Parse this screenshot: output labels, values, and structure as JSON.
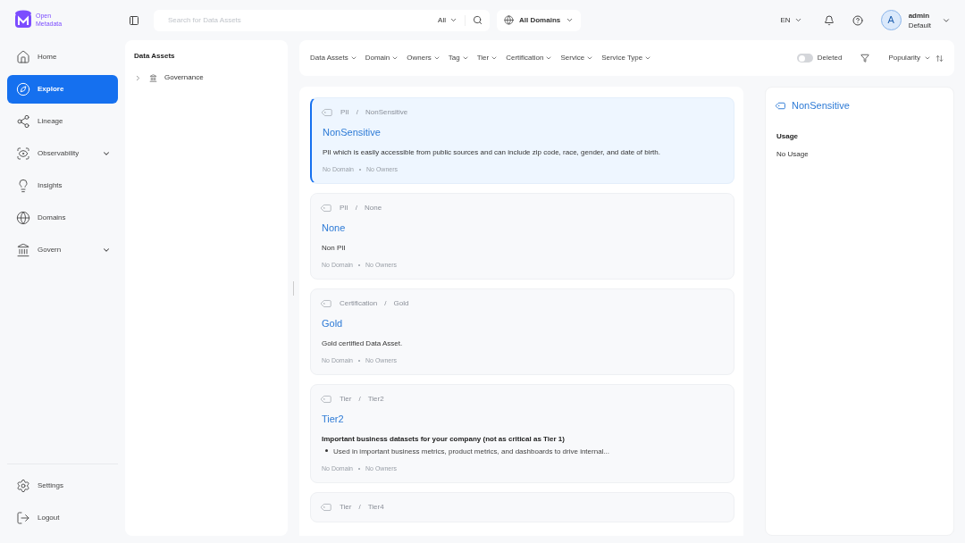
{
  "logo": {
    "line1": "Open",
    "line2": "Metadata"
  },
  "nav": [
    {
      "label": "Home",
      "selected": false,
      "expandable": false
    },
    {
      "label": "Explore",
      "selected": true,
      "expandable": false
    },
    {
      "label": "Lineage",
      "selected": false,
      "expandable": false
    },
    {
      "label": "Observability",
      "selected": false,
      "expandable": true
    },
    {
      "label": "Insights",
      "selected": false,
      "expandable": false
    },
    {
      "label": "Domains",
      "selected": false,
      "expandable": false
    },
    {
      "label": "Govern",
      "selected": false,
      "expandable": true
    }
  ],
  "nav_bottom": [
    {
      "label": "Settings"
    },
    {
      "label": "Logout"
    }
  ],
  "search": {
    "placeholder": "Search for Data Assets",
    "scope": "All"
  },
  "domain_select": "All Domains",
  "language": "EN",
  "user": {
    "initial": "A",
    "name": "admin",
    "role": "Default"
  },
  "tree": {
    "title": "Data Assets",
    "items": [
      {
        "label": "Governance",
        "expanded": false
      }
    ]
  },
  "filters": [
    "Data Assets",
    "Domain",
    "Owners",
    "Tag",
    "Tier",
    "Certification",
    "Service",
    "Service Type"
  ],
  "deleted_toggle": {
    "label": "Deleted",
    "on": false
  },
  "sort": "Popularity",
  "cards": [
    {
      "parent": "PII",
      "separator": "/",
      "name": "NonSensitive",
      "title": "NonSensitive",
      "selected": true,
      "description": "PII which is easily accessible from public sources and can include zip code, race, gender, and date of birth.",
      "domain": "No Domain",
      "owners": "No Owners"
    },
    {
      "parent": "PII",
      "separator": "/",
      "name": "None",
      "title": "None",
      "selected": false,
      "description": "Non PII",
      "domain": "No Domain",
      "owners": "No Owners"
    },
    {
      "parent": "Certification",
      "separator": "/",
      "name": "Gold",
      "title": "Gold",
      "selected": false,
      "description": "Gold certified Data Asset.",
      "domain": "No Domain",
      "owners": "No Owners"
    },
    {
      "parent": "Tier",
      "separator": "/",
      "name": "Tier2",
      "title": "Tier2",
      "selected": false,
      "heading": "Important business datasets for your company (not as critical as Tier 1)",
      "bullets": [
        "Used in important business metrics, product metrics, and dashboards to drive internal..."
      ],
      "domain": "No Domain",
      "owners": "No Owners"
    },
    {
      "parent": "Tier",
      "separator": "/",
      "name": "Tier4",
      "selected": false
    }
  ],
  "detail": {
    "title": "NonSensitive",
    "section": "Usage",
    "value": "No Usage"
  }
}
